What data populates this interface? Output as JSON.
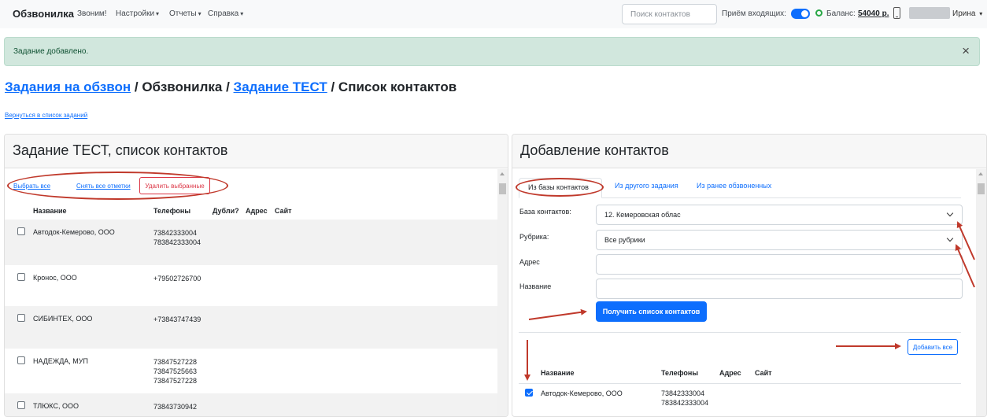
{
  "navbar": {
    "brand": "Обзвонилка",
    "items": [
      {
        "label": "Звоним!",
        "caret": ""
      },
      {
        "label": "Настройки",
        "caret": "▾"
      },
      {
        "label": "Отчеты",
        "caret": "▾"
      },
      {
        "label": "Справка",
        "caret": "▾"
      }
    ],
    "search_placeholder": "Поиск контактов",
    "incoming_label": "Приём входящих:",
    "balance_label": "Баланс:",
    "balance_value": "54040 р.",
    "user_name": "Ирина",
    "user_caret": "▾"
  },
  "alert": {
    "text": "Задание добавлено.",
    "close": "×"
  },
  "breadcrumb": {
    "part1": "Задания на обзвон",
    "sep1": " / Обзвонилка / ",
    "part2": "Задание ТЕСТ",
    "sep2": " / Список контактов"
  },
  "back_link": "Вернуться в список заданий",
  "left_card": {
    "title": "Задание ТЕСТ, список контактов",
    "select_all": "Выбрать все",
    "clear_all": "Снять все отметки",
    "delete_selected": "Удалить выбранные",
    "columns": [
      "Название",
      "Телефоны",
      "Дубли?",
      "Адрес",
      "Сайт"
    ],
    "rows": [
      {
        "name": "Автодок-Кемерово, ООО",
        "phones": [
          "73842333004",
          "783842333004"
        ]
      },
      {
        "name": "Кронос, ООО",
        "phones": [
          "+79502726700"
        ]
      },
      {
        "name": "СИБИНТЕХ, ООО",
        "phones": [
          "+73843747439"
        ]
      },
      {
        "name": "НАДЕЖДА, МУП",
        "phones": [
          "73847527228",
          "73847525663",
          "73847527228"
        ]
      },
      {
        "name": "ТЛЮКС, ООО",
        "phones": [
          "73843730942"
        ]
      }
    ]
  },
  "right_card": {
    "title": "Добавление контактов",
    "tabs": [
      "Из базы контактов",
      "Из другого задания",
      "Из ранее обзвоненных"
    ],
    "fields": {
      "base_label": "База контактов:",
      "base_value": "12. Кемеровская облас",
      "rubric_label": "Рубрика:",
      "rubric_value": "Все рубрики",
      "address_label": "Адрес",
      "address_value": "",
      "name_label": "Название",
      "name_value": ""
    },
    "get_list_button": "Получить список контактов",
    "add_all_button": "Добавить все",
    "columns": [
      "Название",
      "Телефоны",
      "Адрес",
      "Сайт"
    ],
    "rows": [
      {
        "name": "Автодок-Кемерово, ООО",
        "phones": [
          "73842333004",
          "783842333004"
        ],
        "checked": true
      }
    ]
  },
  "colors": {
    "accent": "#0d6efd",
    "danger": "#dc3545",
    "success_bg": "#d1e7dd",
    "annotation": "#c0392b"
  }
}
